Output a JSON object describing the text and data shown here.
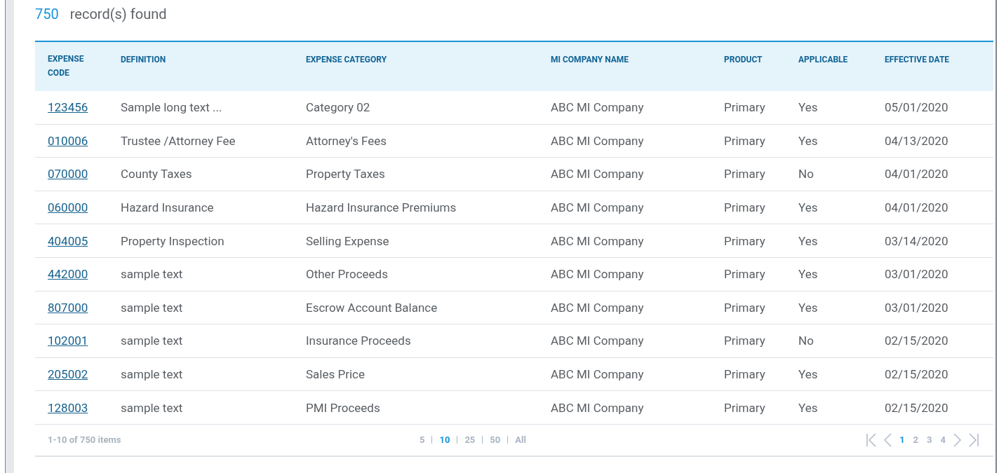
{
  "summary": {
    "count": "750",
    "label": "record(s) found"
  },
  "table": {
    "columns": [
      "EXPENSE CODE",
      "DEFINITION",
      "EXPENSE CATEGORY",
      "MI COMPANY NAME",
      "PRODUCT",
      "APPLICABLE",
      "EFFECTIVE DATE"
    ],
    "rows": [
      [
        "123456",
        "Sample long text ...",
        "Category 02",
        "ABC MI Company",
        "Primary",
        "Yes",
        "05/01/2020"
      ],
      [
        "010006",
        "Trustee /Attorney Fee",
        "Attorney's Fees",
        "ABC MI Company",
        "Primary",
        "Yes",
        "04/13/2020"
      ],
      [
        "070000",
        "County Taxes",
        "Property Taxes",
        "ABC MI Company",
        "Primary",
        "No",
        "04/01/2020"
      ],
      [
        "060000",
        "Hazard Insurance",
        "Hazard Insurance Premiums",
        "ABC MI Company",
        "Primary",
        "Yes",
        "04/01/2020"
      ],
      [
        "404005",
        "Property Inspection",
        "Selling Expense",
        "ABC MI Company",
        "Primary",
        "Yes",
        "03/14/2020"
      ],
      [
        "442000",
        "sample text",
        "Other Proceeds",
        "ABC MI Company",
        "Primary",
        "Yes",
        "03/01/2020"
      ],
      [
        "807000",
        "sample text",
        "Escrow Account Balance",
        "ABC MI Company",
        "Primary",
        "Yes",
        "03/01/2020"
      ],
      [
        "102001",
        "sample text",
        "Insurance Proceeds",
        "ABC MI Company",
        "Primary",
        "No",
        "02/15/2020"
      ],
      [
        "205002",
        "sample text",
        "Sales Price",
        "ABC MI Company",
        "Primary",
        "Yes",
        "02/15/2020"
      ],
      [
        "128003",
        "sample text",
        "PMI Proceeds",
        "ABC MI Company",
        "Primary",
        "Yes",
        "02/15/2020"
      ]
    ]
  },
  "pager": {
    "info": "1-10 of 750 items",
    "page_sizes": [
      {
        "label": "5",
        "selected": false
      },
      {
        "label": "10",
        "selected": true
      },
      {
        "label": "25",
        "selected": false
      },
      {
        "label": "50",
        "selected": false
      },
      {
        "label": "All",
        "selected": false
      }
    ],
    "pages": [
      {
        "label": "1",
        "selected": true
      },
      {
        "label": "2",
        "selected": false
      },
      {
        "label": "3",
        "selected": false
      },
      {
        "label": "4",
        "selected": false
      }
    ]
  }
}
